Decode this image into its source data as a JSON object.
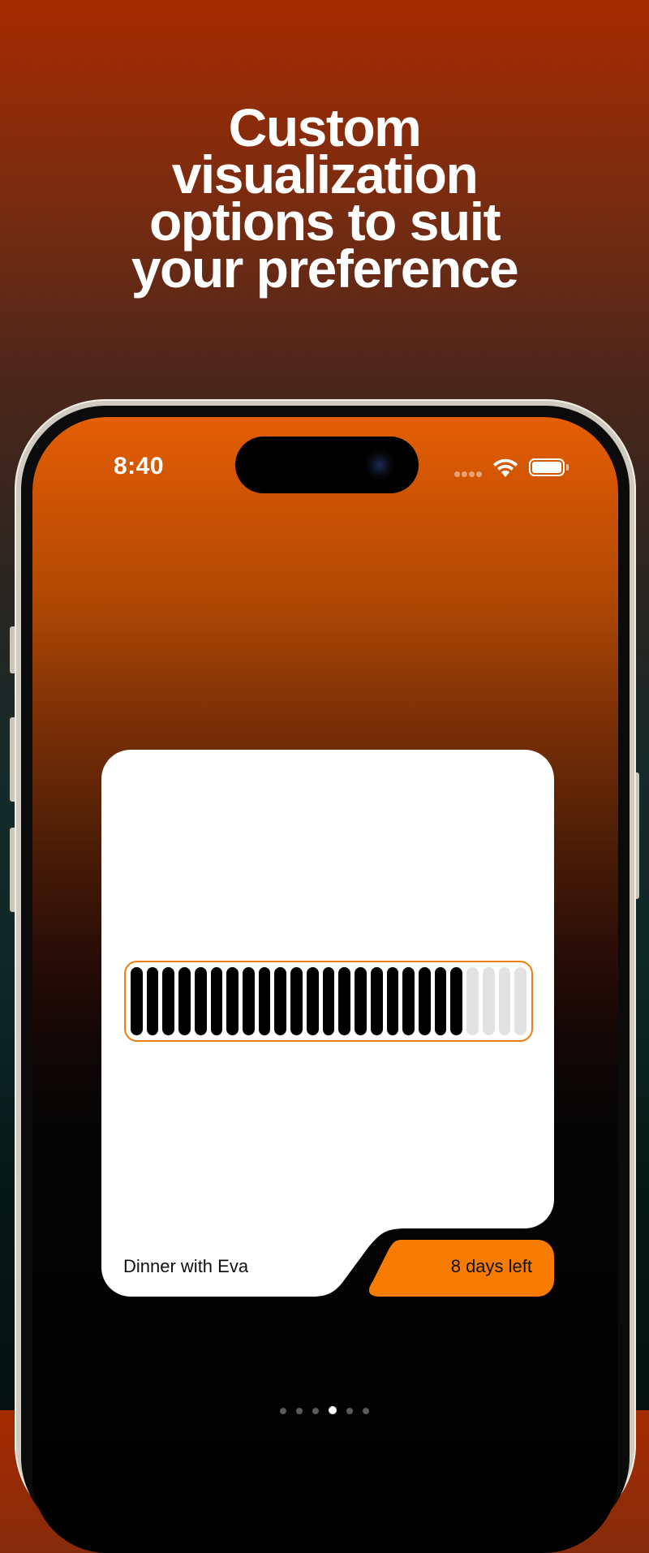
{
  "headline": {
    "line1": "Custom",
    "line2": "visualization",
    "line3": "options to suit",
    "line4": "your preference"
  },
  "status_bar": {
    "time": "8:40",
    "wifi_icon": "wifi-icon",
    "battery_icon": "battery-icon"
  },
  "widget": {
    "event_title": "Dinner with Eva",
    "countdown": "8 days left",
    "progress": {
      "total_segments": 25,
      "filled_segments": 21
    },
    "colors": {
      "accent": "#f57c00",
      "filled": "#000000",
      "empty": "#e2e2e2",
      "card": "#ffffff"
    }
  },
  "pager": {
    "count": 6,
    "active_index": 3
  },
  "colors": {
    "background_top": "#a52a00",
    "screen_top": "#e45e05"
  }
}
